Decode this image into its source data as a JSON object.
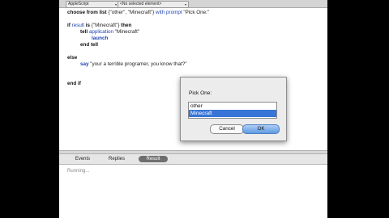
{
  "toolbar": {
    "language": "AppleScript",
    "element": "<No selected element>"
  },
  "script": {
    "l1_kw": "choose from list",
    "l1_rest": " {\"other\", \"Minecraft\"} ",
    "l1_with": "with prompt",
    "l1_str": " \"Pick One:\"",
    "l2_if": "if",
    "l2_result": " result ",
    "l2_is": "is",
    "l2_val": " {\"Minecraft\"} ",
    "l2_then": "then",
    "l3_tell": "tell",
    "l3_app": " application ",
    "l3_str": "\"Minecraft\"",
    "l4_launch": "launch",
    "l5_endtell": "end tell",
    "l6_else": "else",
    "l7_say": "say",
    "l7_str": " \"your a terrible programer, you know that?\"",
    "l8_endif": "end if"
  },
  "tabs": {
    "events": "Events",
    "replies": "Replies",
    "result": "Result"
  },
  "log": {
    "status": "Running..."
  },
  "dialog": {
    "prompt": "Pick One:",
    "options": [
      "other",
      "Minecraft"
    ],
    "selected": "Minecraft",
    "cancel": "Cancel",
    "ok": "OK"
  }
}
